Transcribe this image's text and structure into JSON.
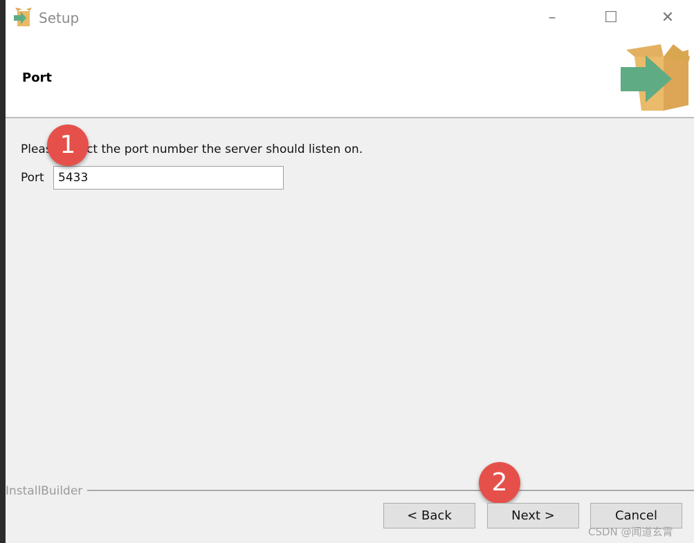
{
  "window": {
    "title": "Setup",
    "minimize_icon": "minimize-icon",
    "maximize_icon": "maximize-icon",
    "close_icon": "close-icon"
  },
  "header": {
    "title": "Port"
  },
  "content": {
    "instruction": "Please select the port number the server should listen on.",
    "port_label": "Port",
    "port_value": "5433"
  },
  "annotations": {
    "badge1": "1",
    "badge2": "2",
    "badge_color": "#e5514a"
  },
  "footer": {
    "brand": "InstallBuilder",
    "back": "< Back",
    "next": "Next >",
    "cancel": "Cancel"
  },
  "watermark": "CSDN @闻道玄霄"
}
